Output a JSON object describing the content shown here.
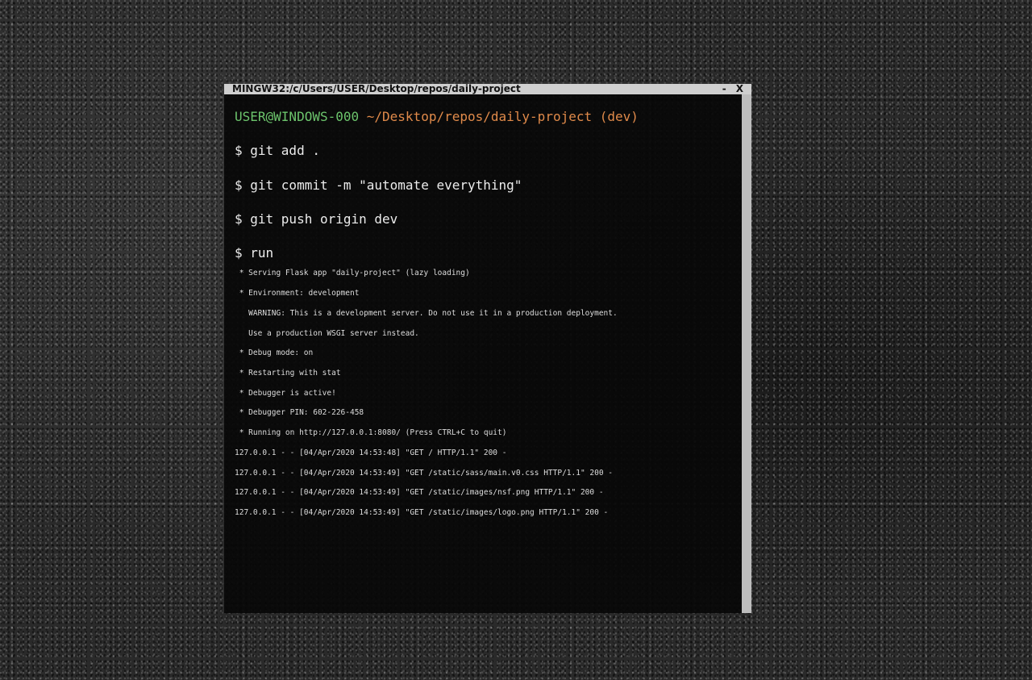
{
  "window": {
    "title": "MINGW32:/c/Users/USER/Desktop/repos/daily-project",
    "minimize_label": "-",
    "close_label": "X"
  },
  "prompt": {
    "user_host": "USER@WINDOWS-000",
    "path_branch": " ~/Desktop/repos/daily-project (dev)"
  },
  "commands": [
    "$ git add .",
    "$ git commit -m \"automate everything\"",
    "$ git push origin dev",
    "$ run"
  ],
  "output": [
    " * Serving Flask app \"daily-project\" (lazy loading)",
    " * Environment: development",
    "   WARNING: This is a development server. Do not use it in a production deployment.",
    "   Use a production WSGI server instead.",
    " * Debug mode: on",
    " * Restarting with stat",
    " * Debugger is active!",
    " * Debugger PIN: 602-226-458",
    " * Running on http://127.0.0.1:8080/ (Press CTRL+C to quit)",
    "127.0.0.1 - - [04/Apr/2020 14:53:48] \"GET / HTTP/1.1\" 200 -",
    "127.0.0.1 - - [04/Apr/2020 14:53:49] \"GET /static/sass/main.v0.css HTTP/1.1\" 200 -",
    "127.0.0.1 - - [04/Apr/2020 14:53:49] \"GET /static/images/nsf.png HTTP/1.1\" 200 -",
    "127.0.0.1 - - [04/Apr/2020 14:53:49] \"GET /static/images/logo.png HTTP/1.1\" 200 -"
  ]
}
